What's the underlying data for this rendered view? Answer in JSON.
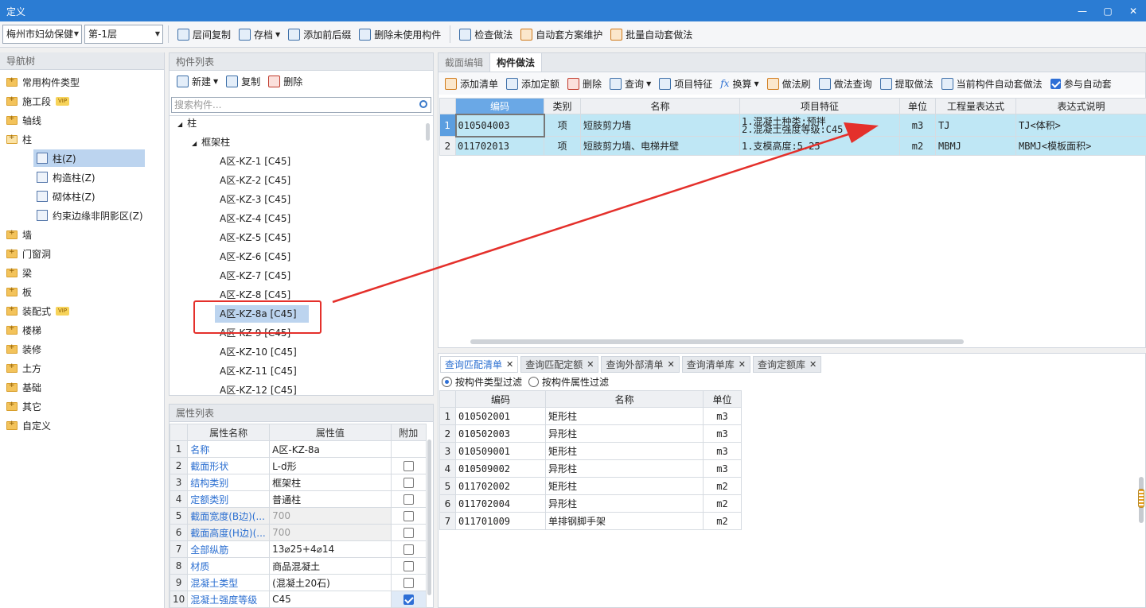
{
  "window": {
    "title": "定义",
    "buttons": [
      "—",
      "▢",
      "✕"
    ]
  },
  "toolbar": {
    "project_combo": "梅州市妇幼保健",
    "floor_combo": "第-1层",
    "buttons": [
      "层间复制",
      "存档",
      "添加前后缀",
      "删除未使用构件",
      "检查做法",
      "自动套方案维护",
      "批量自动套做法"
    ]
  },
  "nav": {
    "header": "导航树",
    "items": [
      {
        "label": "常用构件类型",
        "vip": false
      },
      {
        "label": "施工段",
        "vip": true
      },
      {
        "label": "轴线",
        "vip": false
      },
      {
        "label": "柱",
        "vip": false
      },
      {
        "label": "墙",
        "vip": false
      },
      {
        "label": "门窗洞",
        "vip": false
      },
      {
        "label": "梁",
        "vip": false
      },
      {
        "label": "板",
        "vip": false
      },
      {
        "label": "装配式",
        "vip": true
      },
      {
        "label": "楼梯",
        "vip": false
      },
      {
        "label": "装修",
        "vip": false
      },
      {
        "label": "土方",
        "vip": false
      },
      {
        "label": "基础",
        "vip": false
      },
      {
        "label": "其它",
        "vip": false
      },
      {
        "label": "自定义",
        "vip": false
      }
    ],
    "vip_label": "VIP",
    "sub_items": [
      "柱(Z)",
      "构造柱(Z)",
      "砌体柱(Z)",
      "约束边缘非阴影区(Z)"
    ]
  },
  "complist": {
    "header": "构件列表",
    "buttons": [
      "新建",
      "复制",
      "删除"
    ],
    "search_placeholder": "搜索构件...",
    "root": "柱",
    "group": "框架柱",
    "items": [
      "A区-KZ-1 [C45]",
      "A区-KZ-2 [C45]",
      "A区-KZ-3 [C45]",
      "A区-KZ-4 [C45]",
      "A区-KZ-5 [C45]",
      "A区-KZ-6 [C45]",
      "A区-KZ-7 [C45]",
      "A区-KZ-8 [C45]",
      "A区-KZ-8a [C45]",
      "A区-KZ-9 [C45]",
      "A区-KZ-10 [C45]",
      "A区-KZ-11 [C45]",
      "A区-KZ-12 [C45]"
    ]
  },
  "props": {
    "header": "属性列表",
    "columns": [
      "属性名称",
      "属性值",
      "附加"
    ],
    "rows": [
      {
        "n": "1",
        "name": "名称",
        "value": "A区-KZ-8a"
      },
      {
        "n": "2",
        "name": "截面形状",
        "value": "L-d形"
      },
      {
        "n": "3",
        "name": "结构类别",
        "value": "框架柱"
      },
      {
        "n": "4",
        "name": "定额类别",
        "value": "普通柱"
      },
      {
        "n": "5",
        "name": "截面宽度(B边)(...",
        "value": "700"
      },
      {
        "n": "6",
        "name": "截面高度(H边)(...",
        "value": "700"
      },
      {
        "n": "7",
        "name": "全部纵筋",
        "value": "13⌀25+4⌀14"
      },
      {
        "n": "8",
        "name": "材质",
        "value": "商品混凝土"
      },
      {
        "n": "9",
        "name": "混凝土类型",
        "value": "(混凝土20石)"
      },
      {
        "n": "10",
        "name": "混凝土强度等级",
        "value": "C45"
      }
    ]
  },
  "rtop": {
    "tabs": [
      "截面编辑",
      "构件做法"
    ],
    "buttons": [
      "添加清单",
      "添加定额",
      "删除",
      "查询",
      "项目特征",
      "换算",
      "做法刷",
      "做法查询",
      "提取做法",
      "当前构件自动套做法",
      "参与自动套"
    ],
    "columns": [
      "编码",
      "类别",
      "名称",
      "项目特征",
      "单位",
      "工程量表达式",
      "表达式说明"
    ],
    "rows": [
      {
        "n": "1",
        "code": "010504003",
        "type": "项",
        "name": "短肢剪力墙",
        "feat1": "1.混凝土种类:预拌",
        "feat2": "2.混凝土强度等级:C45",
        "unit": "m3",
        "expr": "TJ",
        "desc": "TJ<体积>"
      },
      {
        "n": "2",
        "code": "011702013",
        "type": "项",
        "name": "短肢剪力墙、电梯井壁",
        "feat1": "1.支模高度:5.25",
        "feat2": "",
        "unit": "m2",
        "expr": "MBMJ",
        "desc": "MBMJ<模板面积>"
      }
    ]
  },
  "rbot": {
    "tabs": [
      "查询匹配清单",
      "查询匹配定额",
      "查询外部清单",
      "查询清单库",
      "查询定额库"
    ],
    "filters": [
      "按构件类型过滤",
      "按构件属性过滤"
    ],
    "columns": [
      "编码",
      "名称",
      "单位"
    ],
    "rows": [
      {
        "n": "1",
        "code": "010502001",
        "name": "矩形柱",
        "unit": "m3"
      },
      {
        "n": "2",
        "code": "010502003",
        "name": "异形柱",
        "unit": "m3"
      },
      {
        "n": "3",
        "code": "010509001",
        "name": "矩形柱",
        "unit": "m3"
      },
      {
        "n": "4",
        "code": "010509002",
        "name": "异形柱",
        "unit": "m3"
      },
      {
        "n": "5",
        "code": "011702002",
        "name": "矩形柱",
        "unit": "m2"
      },
      {
        "n": "6",
        "code": "011702004",
        "name": "异形柱",
        "unit": "m2"
      },
      {
        "n": "7",
        "code": "011701009",
        "name": "单排钢脚手架",
        "unit": "m2"
      }
    ]
  },
  "colors": {
    "titlebar": "#2b7cd3",
    "selection": "#bcd4ef",
    "row_highlight": "#bfe7f5",
    "annotation": "#e4302b"
  }
}
